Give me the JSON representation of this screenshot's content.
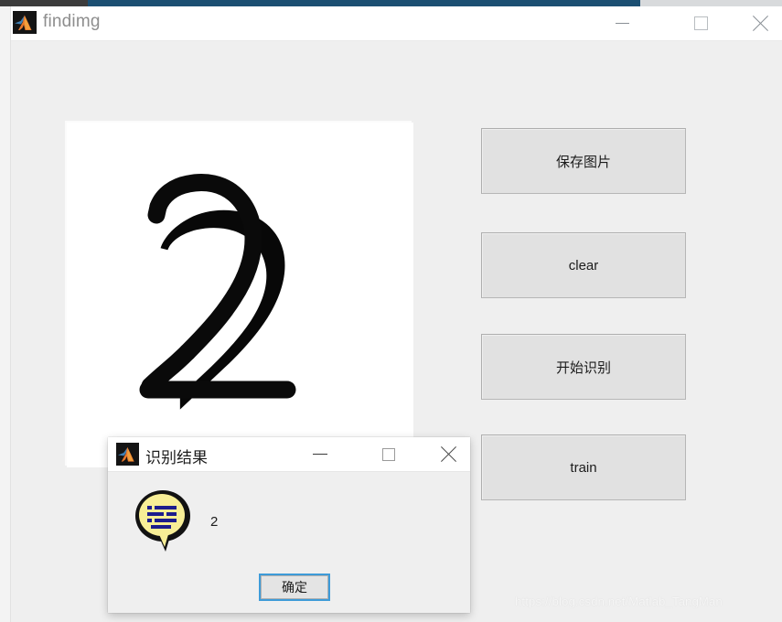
{
  "background": {
    "top_strip_color": "#1b4f72",
    "left_edge_color": "#f3f3f3"
  },
  "window": {
    "title": "findimg",
    "icon": "matlab-logo-icon",
    "background_color": "#efefef",
    "titlebar_color": "#ffffff",
    "controls": {
      "minimize": "minimize-icon",
      "maximize": "maximize-icon",
      "close": "close-icon"
    }
  },
  "canvas": {
    "name": "drawing-canvas",
    "background_color": "#ffffff",
    "drawn_digit": "2",
    "stroke_color": "#000000"
  },
  "buttons": [
    {
      "label": "保存图片",
      "name": "save-image-button"
    },
    {
      "label": "clear",
      "name": "clear-button"
    },
    {
      "label": "开始识别",
      "name": "start-recognition-button"
    },
    {
      "label": "train",
      "name": "train-button"
    }
  ],
  "dialog": {
    "title": "识别结果",
    "icon": "matlab-logo-icon",
    "message": "2",
    "ok_label": "确定",
    "icon_type": "speech-bubble-info-icon",
    "icon_fill": "#f5ec93",
    "icon_line_color": "#1c1c8c",
    "focus_border_color": "#3e9bd8",
    "controls": {
      "minimize": "minimize-icon",
      "maximize": "maximize-icon",
      "close": "close-icon"
    }
  },
  "watermark": {
    "text": "https://blog.csdn.net/Matlab_TangMan"
  }
}
